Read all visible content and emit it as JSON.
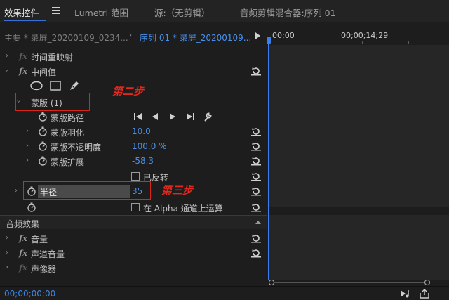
{
  "tabs": [
    {
      "label": "效果控件",
      "active": true
    },
    {
      "label": "Lumetri 范围",
      "active": false
    },
    {
      "label": "源:（无剪辑）",
      "active": false
    },
    {
      "label": "音频剪辑混合器:序列 01",
      "active": false
    }
  ],
  "header": {
    "main_label": "主要 * 录屏_20200109_0234...",
    "sequence_label": "序列 01 * 录屏_20200109...",
    "time_start": "00:00",
    "time_mid": "00;00;14;29"
  },
  "rows": {
    "time_remap": "时间重映射",
    "intermediate": "中间值",
    "mask": "蒙版 (1)",
    "mask_path": "蒙版路径",
    "mask_feather": {
      "label": "蒙版羽化",
      "value": "10.0"
    },
    "mask_opacity": {
      "label": "蒙版不透明度",
      "value": "100.0 %"
    },
    "mask_expansion": {
      "label": "蒙版扩展",
      "value": "-58.3"
    },
    "inverted": "已反转",
    "radius": {
      "label": "半径",
      "value": "35"
    },
    "alpha": "在 Alpha 通道上运算"
  },
  "audio": {
    "section_title": "音频效果",
    "volume": "音量",
    "channel_volume": "声道音量",
    "panner": "声像器"
  },
  "annotations": {
    "step2": "第二步",
    "step3": "第三步"
  },
  "footer": {
    "timecode": "00;00;00;00"
  },
  "colors": {
    "accent": "#3a7ef0",
    "value_blue": "#4a8fe7",
    "annotation_red": "#e0281e"
  }
}
